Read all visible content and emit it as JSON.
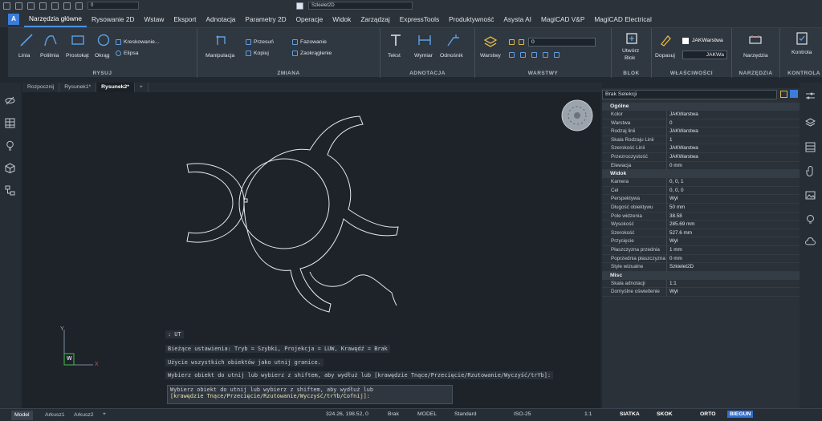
{
  "quick_access": {
    "layer_value": "0",
    "workspace_value": "Szkielet2D"
  },
  "ribbon_tabs": [
    "Narzędzia główne",
    "Rysowanie 2D",
    "Wstaw",
    "Eksport",
    "Adnotacja",
    "Parametry 2D",
    "Operacje",
    "Widok",
    "Zarządzaj",
    "ExpressTools",
    "Produktywność",
    "Asysta AI",
    "MagiCAD V&P",
    "MagiCAD Electrical"
  ],
  "ribbon": {
    "rysuj": {
      "title": "RYSUJ",
      "linia": "Linia",
      "polilinia": "Polilinia",
      "prostokat": "Prostokąt",
      "okrag": "Okrąg",
      "kreskowanie": "Kreskowanie...",
      "elipsa": "Elipsa"
    },
    "zmiana": {
      "title": "ZMIANA",
      "manipulacja": "Manipulacja",
      "przesun": "Przesuń",
      "kopiuj": "Kopiuj",
      "fazowanie": "Fazowanie",
      "zaokraglenie": "Zaokrąglenie"
    },
    "adnotacja": {
      "title": "ADNOTACJA",
      "tekst": "Tekst",
      "wymiar": "Wymiar",
      "odnosnik": "Odnośnik"
    },
    "warstwy": {
      "title": "WARSTWY",
      "warstwy": "Warstwy",
      "layer_value": "0"
    },
    "blok": {
      "title": "BLOK",
      "utworz": "Utwórz",
      "blok": "Blok"
    },
    "wlasciwosci": {
      "title": "WŁAŚCIWOŚCI",
      "dopasuj": "Dopasuj",
      "kolor_value": "JAKWarstwa",
      "linia_value": "JAKWa"
    },
    "narzedzia": {
      "title": "NARZĘDZIA",
      "narzedzia": "Narzędzia"
    },
    "kontrola": {
      "title": "KONTROLA",
      "kontrola": "Kontrola"
    }
  },
  "doc_tabs": [
    "Rozpocznij",
    "Rysunek1*",
    "Rysunek2*",
    "+"
  ],
  "command_lines": [
    ": UT",
    "Bieżące ustawienia: Tryb = Szybki, Projekcja = LUW, Krawędź = Brak",
    "Użycie wszystkich obiektów jako utnij granice.",
    "Wybierz obiekt do utnij lub wybierz z shiftem, aby wydłuż lub [krawędzie Tnące/Przecięcie/Rzutowanie/Wyczyść/trYb]:",
    "Wybierz obiekt do utnij lub wybierz z shiftem, aby wydłuż lub",
    "[krawędzie Tnące/Przecięcie/Rzutowanie/Wyczyść/trYb/Cofnij]:"
  ],
  "ucs": {
    "x": "X",
    "y": "Y",
    "w": "W"
  },
  "properties": {
    "selection": "Brak Selekcji",
    "sections": [
      {
        "name": "Ogólne",
        "rows": [
          {
            "name": "Kolor",
            "value": "JAKWarstwa"
          },
          {
            "name": "Warstwa",
            "value": "0"
          },
          {
            "name": "Rodzaj linii",
            "value": "JAKWarstwa"
          },
          {
            "name": "Skala Rodzaju Linii",
            "value": "1"
          },
          {
            "name": "Szerokość Linii",
            "value": "JAKWarstwa"
          },
          {
            "name": "Przezroczystość",
            "value": "JAKWarstwa"
          },
          {
            "name": "Elewacja",
            "value": "0 mm"
          }
        ]
      },
      {
        "name": "Widok",
        "rows": [
          {
            "name": "Kamera",
            "value": "0, 0, 1"
          },
          {
            "name": "Cel",
            "value": "0, 0, 0"
          },
          {
            "name": "Perspektywa",
            "value": "Wył"
          },
          {
            "name": "Długość obiektywu",
            "value": "50 mm"
          },
          {
            "name": "Pole widzenia",
            "value": "38.58"
          },
          {
            "name": "Wysokość",
            "value": "285.69 mm"
          },
          {
            "name": "Szerokość",
            "value": "527.6 mm"
          },
          {
            "name": "Przycięcie",
            "value": "Wył"
          },
          {
            "name": "Płaszczyzna przednia",
            "value": "1 mm"
          },
          {
            "name": "Poprzednia płaszczyzna",
            "value": "0 mm"
          },
          {
            "name": "Style wizualne",
            "value": "Szkielet2D"
          }
        ]
      },
      {
        "name": "Misc",
        "rows": [
          {
            "name": "Skala adnotacji",
            "value": "1:1"
          },
          {
            "name": "Domyślne oświetlenie",
            "value": "Wył"
          }
        ]
      }
    ]
  },
  "status": {
    "layout_tabs": [
      "Model",
      "Arkusz1",
      "Arkusz2"
    ],
    "coords": "324.26, 198.52, 0",
    "brak": "Brak",
    "model": "MODEL",
    "standard": "Standard",
    "iso": "ISO-25",
    "scale": "1:1",
    "siatka": "SIATKA",
    "skok": "SKOK",
    "orto": "ORTO",
    "biegun": "BIEGUN"
  }
}
